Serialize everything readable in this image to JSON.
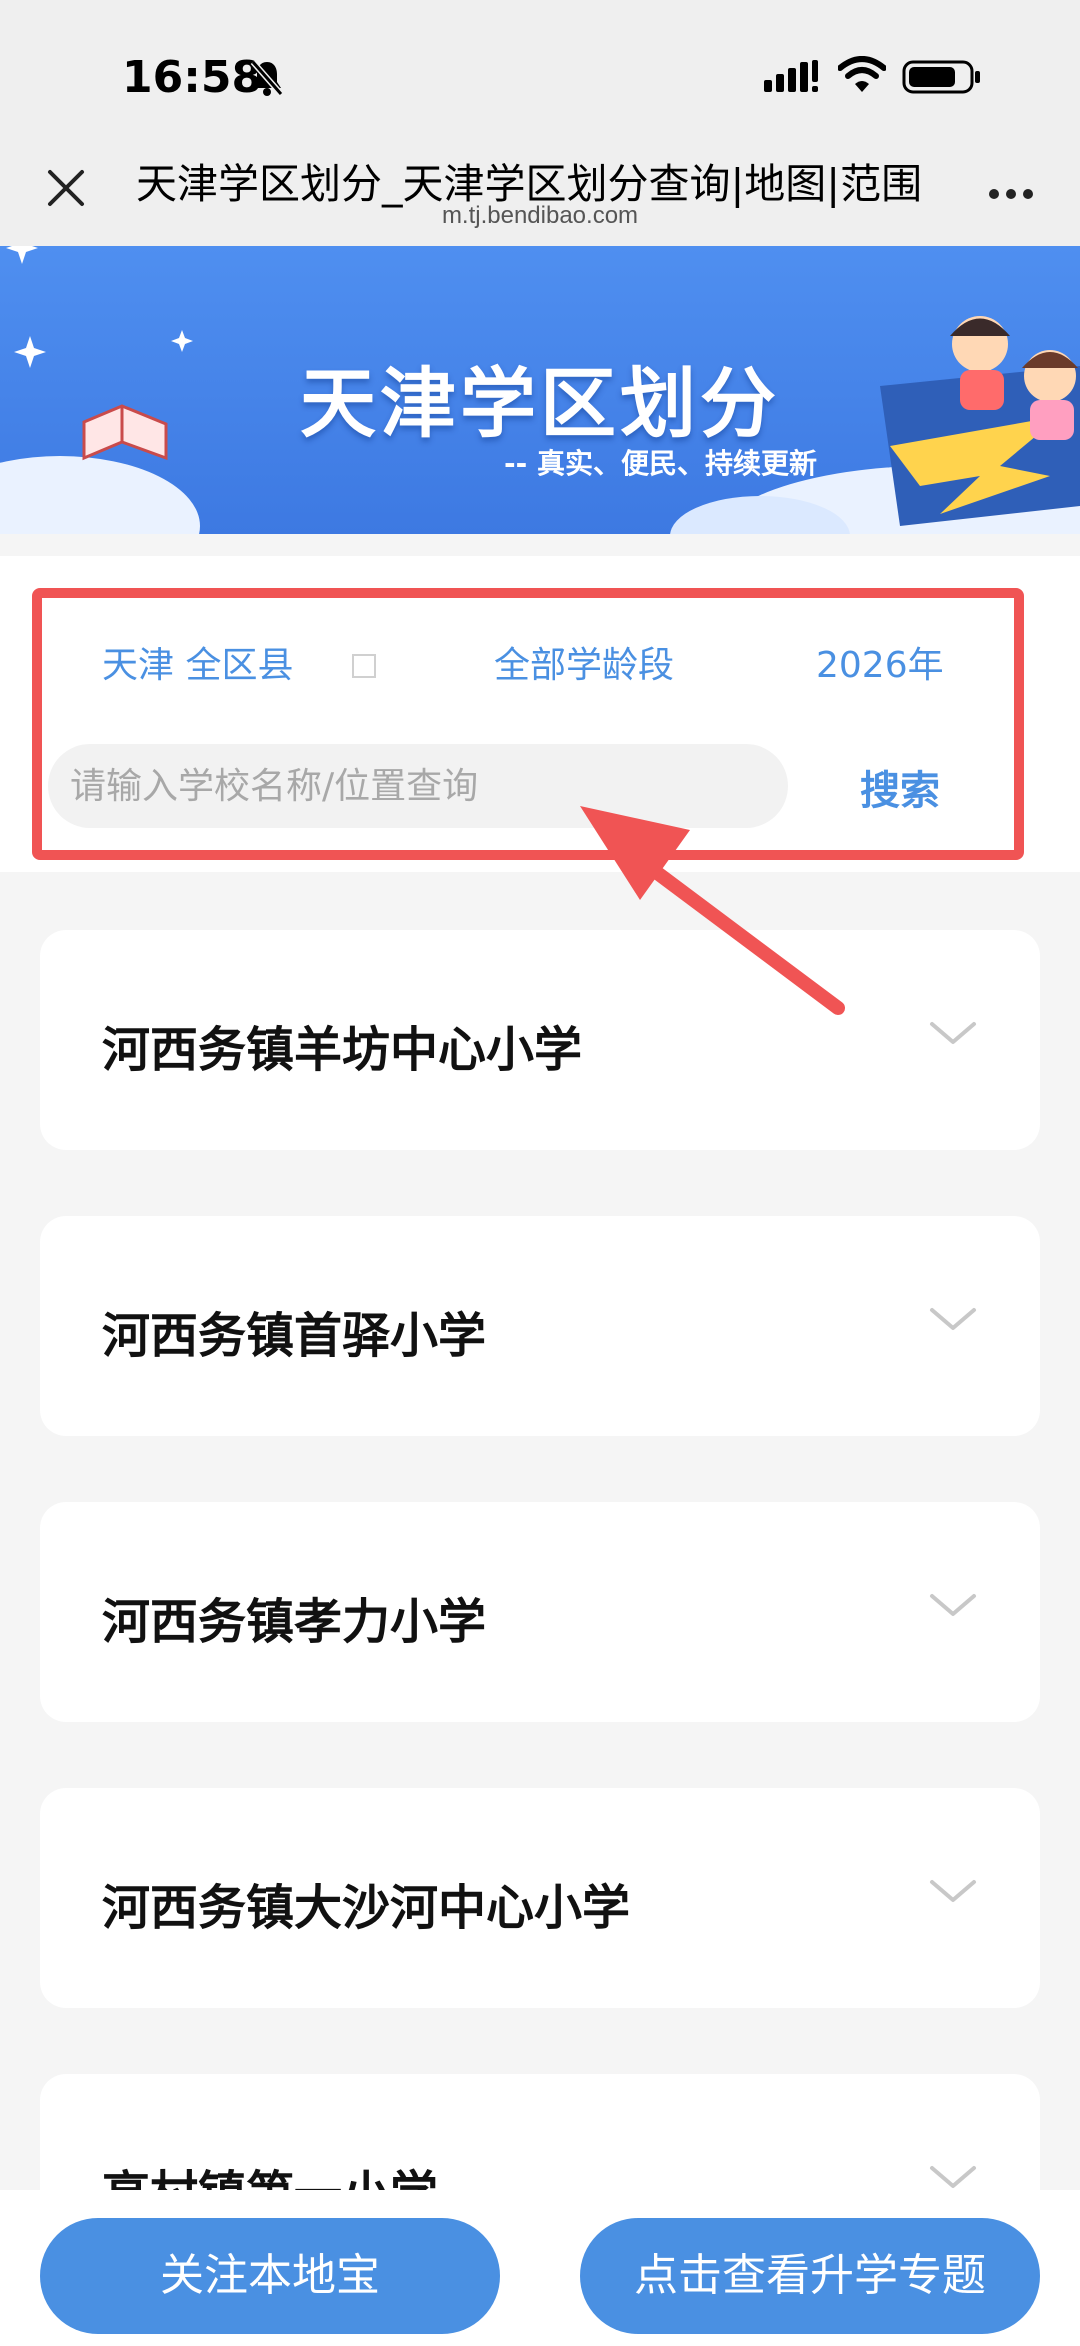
{
  "status_bar": {
    "time": "16:58"
  },
  "nav": {
    "title": "天津学区划分_天津学区划分查询|地图|范围",
    "url": "m.tj.bendibao.com"
  },
  "banner": {
    "title": "天津学区划分",
    "subtitle": "-- 真实、便民、持续更新"
  },
  "filters": {
    "region": "天津 全区县",
    "stage": "全部学龄段",
    "year": "2026年"
  },
  "search": {
    "placeholder": "请输入学校名称/位置查询",
    "button": "搜索"
  },
  "schools": [
    {
      "name": "河西务镇羊坊中心小学"
    },
    {
      "name": "河西务镇首驿小学"
    },
    {
      "name": "河西务镇孝力小学"
    },
    {
      "name": "河西务镇大沙河中心小学"
    },
    {
      "name": "高村镇第一小学"
    }
  ],
  "bottom": {
    "follow": "关注本地宝",
    "topic": "点击查看升学专题"
  },
  "colors": {
    "accent": "#4a90e2",
    "highlight_box": "#f05454",
    "banner": "#3d79e2"
  }
}
